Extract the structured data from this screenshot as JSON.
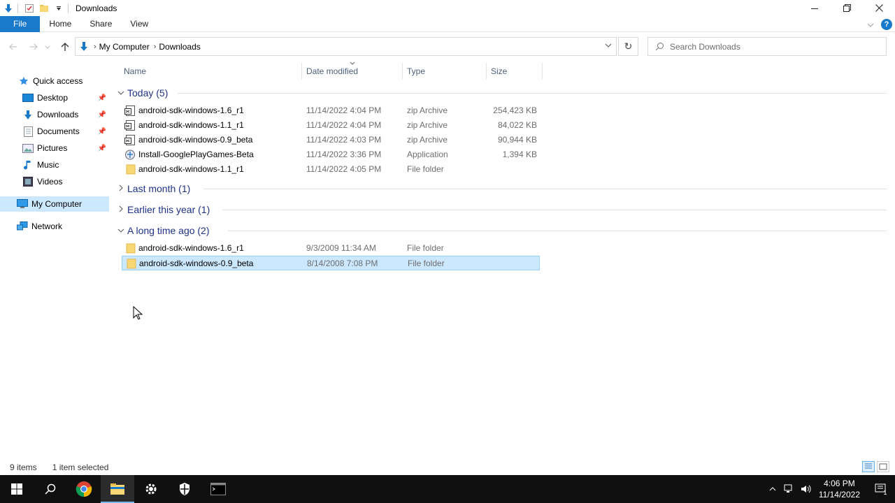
{
  "window": {
    "title": "Downloads",
    "controls": {
      "minimize": "—",
      "maximize": "❐",
      "close": "✕"
    }
  },
  "ribbon": {
    "tabs": [
      "File",
      "Home",
      "Share",
      "View"
    ]
  },
  "address": {
    "breadcrumbs": [
      "My Computer",
      "Downloads"
    ],
    "search_placeholder": "Search Downloads"
  },
  "nav": {
    "items": [
      {
        "label": "Quick access",
        "icon": "star-icon",
        "pinned": false,
        "selected": false
      },
      {
        "label": "Desktop",
        "icon": "desktop-icon",
        "pinned": true,
        "selected": false
      },
      {
        "label": "Downloads",
        "icon": "download-icon",
        "pinned": true,
        "selected": false
      },
      {
        "label": "Documents",
        "icon": "documents-icon",
        "pinned": true,
        "selected": false
      },
      {
        "label": "Pictures",
        "icon": "pictures-icon",
        "pinned": true,
        "selected": false
      },
      {
        "label": "Music",
        "icon": "music-icon",
        "pinned": false,
        "selected": false
      },
      {
        "label": "Videos",
        "icon": "videos-icon",
        "pinned": false,
        "selected": false
      },
      {
        "label": "My Computer",
        "icon": "computer-icon",
        "pinned": false,
        "selected": true
      },
      {
        "label": "Network",
        "icon": "network-icon",
        "pinned": false,
        "selected": false
      }
    ]
  },
  "columns": [
    "Name",
    "Date modified",
    "Type",
    "Size"
  ],
  "groups": [
    {
      "title": "Today (5)",
      "expanded": true,
      "files": [
        {
          "name": "android-sdk-windows-1.6_r1",
          "date": "11/14/2022 4:04 PM",
          "type": "zip Archive",
          "size": "254,423 KB",
          "icon": "zip-icon"
        },
        {
          "name": "android-sdk-windows-1.1_r1",
          "date": "11/14/2022 4:04 PM",
          "type": "zip Archive",
          "size": "84,022 KB",
          "icon": "zip-icon"
        },
        {
          "name": "android-sdk-windows-0.9_beta",
          "date": "11/14/2022 4:03 PM",
          "type": "zip Archive",
          "size": "90,944 KB",
          "icon": "zip-icon"
        },
        {
          "name": "Install-GooglePlayGames-Beta",
          "date": "11/14/2022 3:36 PM",
          "type": "Application",
          "size": "1,394 KB",
          "icon": "installer-icon"
        },
        {
          "name": "android-sdk-windows-1.1_r1",
          "date": "11/14/2022 4:05 PM",
          "type": "File folder",
          "size": "",
          "icon": "folder-icon"
        }
      ]
    },
    {
      "title": "Last month (1)",
      "expanded": false,
      "files": []
    },
    {
      "title": "Earlier this year (1)",
      "expanded": false,
      "files": []
    },
    {
      "title": "A long time ago (2)",
      "expanded": true,
      "files": [
        {
          "name": "android-sdk-windows-1.6_r1",
          "date": "9/3/2009 11:34 AM",
          "type": "File folder",
          "size": "",
          "icon": "folder-icon"
        },
        {
          "name": "android-sdk-windows-0.9_beta",
          "date": "8/14/2008 7:08 PM",
          "type": "File folder",
          "size": "",
          "icon": "folder-icon",
          "selected": true
        }
      ]
    }
  ],
  "status": {
    "count": "9 items",
    "selection": "1 item selected"
  },
  "taskbar": {
    "time": "4:06 PM",
    "date": "11/14/2022",
    "notification_count": "1"
  },
  "colors": {
    "accent": "#1979ca",
    "selection": "#cce8ff",
    "group_title": "#1e3287"
  }
}
